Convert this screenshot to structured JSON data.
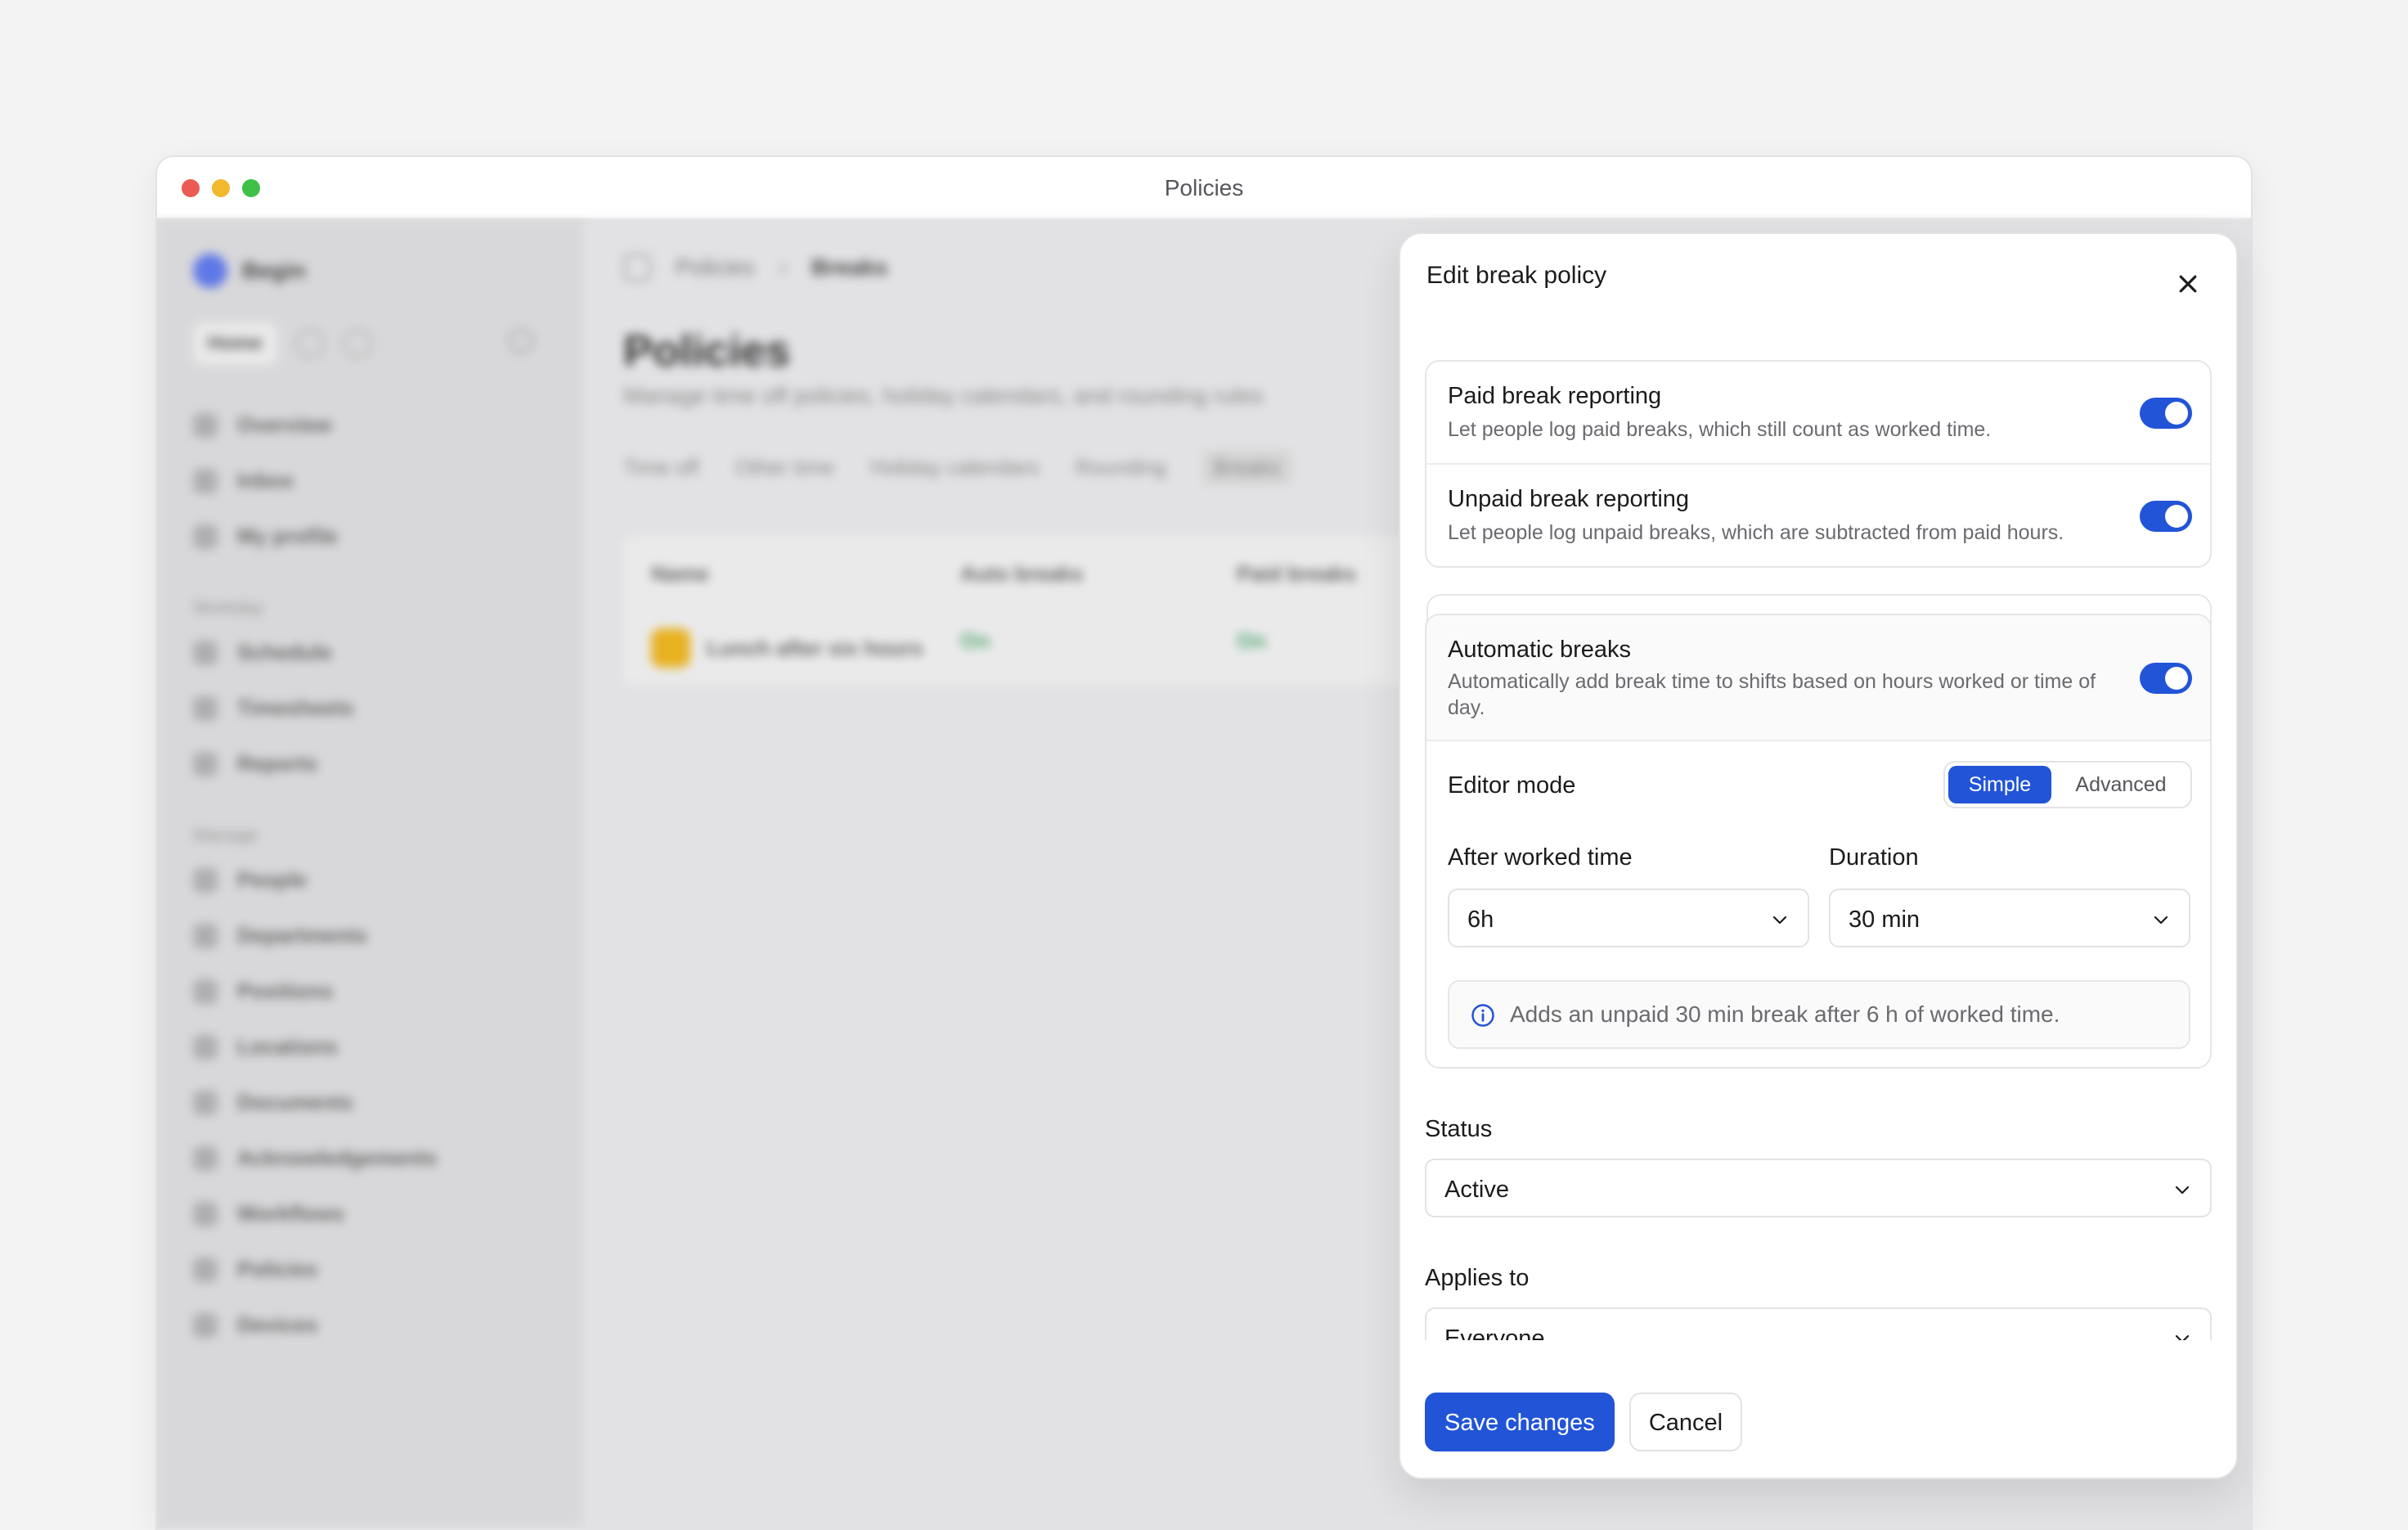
{
  "window": {
    "title": "Policies"
  },
  "background": {
    "workspace": "Begin",
    "home_label": "Home",
    "nav_top": [
      "Overview",
      "Inbox",
      "My profile"
    ],
    "section_workday": "Workday",
    "nav_workday": [
      "Schedule",
      "Timesheets",
      "Reports"
    ],
    "section_manage": "Manage",
    "nav_manage": [
      "People",
      "Departments",
      "Positions",
      "Locations",
      "Documents",
      "Acknowledgements",
      "Workflows",
      "Policies",
      "Devices"
    ],
    "breadcrumb": [
      "Policies",
      "Breaks"
    ],
    "page_title": "Policies",
    "page_subtitle": "Manage time off policies, holiday calendars, and rounding rules",
    "tabs": [
      "Time off",
      "Other time",
      "Holiday calendars",
      "Rounding",
      "Breaks"
    ],
    "table_headers": [
      "Name",
      "Auto breaks",
      "Paid breaks"
    ],
    "table_row": {
      "name": "Lunch after six hours",
      "auto": "On",
      "paid": "On"
    }
  },
  "panel": {
    "title": "Edit break policy",
    "paid_break": {
      "title": "Paid break reporting",
      "description": "Let people log paid breaks, which still count as worked time.",
      "enabled": true
    },
    "unpaid_break": {
      "title": "Unpaid break reporting",
      "description": "Let people log unpaid breaks, which are subtracted from paid hours.",
      "enabled": true
    },
    "automatic_breaks": {
      "title": "Automatic breaks",
      "description_line1": "Automatically add break time to shifts based on hours worked or time of",
      "description_line2": "day.",
      "enabled": true
    },
    "editor_mode": {
      "label": "Editor mode",
      "options": [
        "Simple",
        "Advanced"
      ],
      "selected": "Simple"
    },
    "after_worked_time": {
      "label": "After worked time",
      "value": "6h"
    },
    "duration": {
      "label": "Duration",
      "value": "30 min"
    },
    "info_text": "Adds an unpaid 30 min break after 6 h of worked time.",
    "status": {
      "label": "Status",
      "value": "Active"
    },
    "applies_to": {
      "label": "Applies to",
      "value": "Everyone"
    },
    "save_label": "Save changes",
    "cancel_label": "Cancel"
  },
  "colors": {
    "accent": "#2254d8",
    "bg": "#f3f3f3"
  }
}
